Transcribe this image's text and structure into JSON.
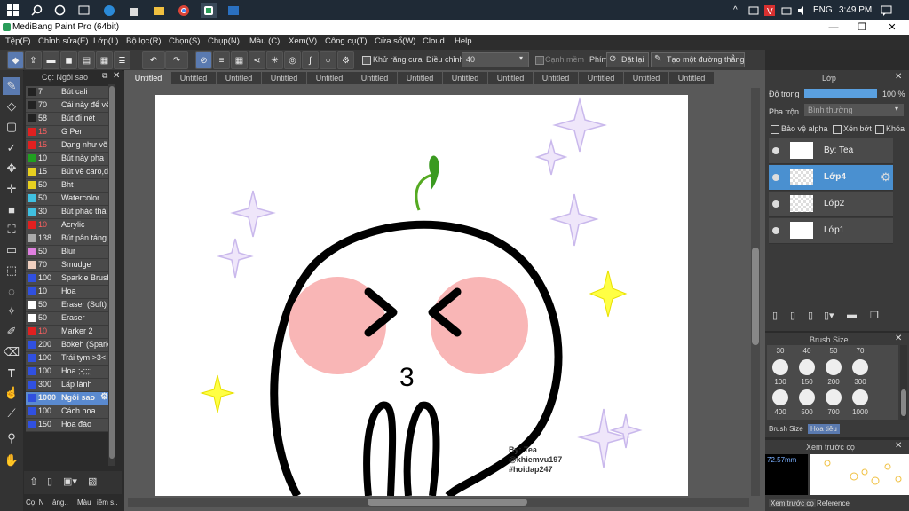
{
  "taskbar": {
    "clock": "3:49 PM",
    "lang": "ENG",
    "chevron": "^"
  },
  "window": {
    "title": "MediBang Paint Pro (64bit)",
    "min": "—",
    "max": "❐",
    "close": "✕"
  },
  "menu": [
    "Tệp(F)",
    "Chỉnh sửa(E)",
    "Lớp(L)",
    "Bộ lọc(R)",
    "Chọn(S)",
    "Chụp(N)",
    "Màu (C)",
    "Xem(V)",
    "Công cụ(T)",
    "Cửa sổ(W)",
    "Cloud",
    "Help"
  ],
  "toolbar": {
    "antialias": "Khử răng cưa",
    "adjust_label": "Điều chỉnh",
    "adjust_value": "40",
    "edge": "Cạnh mềm",
    "key_label": "Phím",
    "reset": "Đặt lại",
    "straight_line": "Tạo một đường thẳng"
  },
  "brush_panel": {
    "title": "Cọ: Ngôi sao",
    "items": [
      {
        "size": "7",
        "name": "Bút cali",
        "color": "#222222"
      },
      {
        "size": "70",
        "name": "Cái này để vẽ",
        "color": "#222222"
      },
      {
        "size": "58",
        "name": "Bút đi nét",
        "color": "#222222"
      },
      {
        "size": "15",
        "name": "G Pen",
        "color": "#e02020"
      },
      {
        "size": "15",
        "name": "Dạng như vẽ",
        "color": "#e02020"
      },
      {
        "size": "10",
        "name": "Bút này pha",
        "color": "#20a020"
      },
      {
        "size": "15",
        "name": "Bút vẽ caro,d",
        "color": "#e8d020"
      },
      {
        "size": "50",
        "name": "Bht",
        "color": "#e8d020"
      },
      {
        "size": "50",
        "name": "Watercolor",
        "color": "#40c0e0"
      },
      {
        "size": "30",
        "name": "Bút phác thả",
        "color": "#40c0e0"
      },
      {
        "size": "10",
        "name": "Acrylic",
        "color": "#e02020"
      },
      {
        "size": "138",
        "name": "Bút pân táng",
        "color": "#aaaaaa"
      },
      {
        "size": "50",
        "name": "Blur",
        "color": "#e080e0"
      },
      {
        "size": "70",
        "name": "Smudge",
        "color": "#f0d0c0"
      },
      {
        "size": "100",
        "name": "Sparkle Brush",
        "color": "#3050e0"
      },
      {
        "size": "10",
        "name": "Hoa",
        "color": "#3050e0"
      },
      {
        "size": "50",
        "name": "Eraser (Soft)",
        "color": "#ffffff"
      },
      {
        "size": "50",
        "name": "Eraser",
        "color": "#ffffff"
      },
      {
        "size": "10",
        "name": "Marker 2",
        "color": "#e02020"
      },
      {
        "size": "200",
        "name": "Bokeh (Spark",
        "color": "#3050e0"
      },
      {
        "size": "100",
        "name": "Trái tym >3<",
        "color": "#3050e0"
      },
      {
        "size": "100",
        "name": "Hoa ;-;;;;",
        "color": "#3050e0"
      },
      {
        "size": "300",
        "name": "Lấp lánh",
        "color": "#3050e0"
      },
      {
        "size": "1000",
        "name": "Ngôi sao",
        "color": "#3050e0"
      },
      {
        "size": "100",
        "name": "Cách hoa",
        "color": "#3050e0"
      },
      {
        "size": "150",
        "name": "Hoa đào",
        "color": "#3050e0"
      }
    ],
    "bottom_tabs": [
      "Cọ: N",
      "ảng..",
      "Màu",
      "iểm s.."
    ]
  },
  "doc_tabs": [
    "Untitled",
    "Untitled",
    "Untitled",
    "Untitled",
    "Untitled",
    "Untitled",
    "Untitled",
    "Untitled",
    "Untitled",
    "Untitled",
    "Untitled",
    "Untitled",
    "Untitled"
  ],
  "canvas": {
    "signature1": "By: Tea",
    "signature2": "@khiemvu197",
    "signature3": "#hoidap247",
    "mouth": "3"
  },
  "layer_panel": {
    "title": "Lớp",
    "opacity_label": "Độ trong",
    "opacity_value": "100 %",
    "blend_label": "Pha trộn",
    "blend_value": "Bình thường",
    "alpha_protect": "Bảo vệ alpha",
    "clipping": "Xén bớt",
    "lock": "Khóa",
    "layers": [
      {
        "name": "By: Tea"
      },
      {
        "name": "Lớp4"
      },
      {
        "name": "Lớp2"
      },
      {
        "name": "Lớp1"
      }
    ]
  },
  "brush_size_panel": {
    "title": "Brush Size",
    "row1": [
      "30",
      "40",
      "50",
      "70"
    ],
    "row2": [
      "100",
      "150",
      "200",
      "300"
    ],
    "row3": [
      "400",
      "500",
      "700",
      "1000"
    ],
    "tabs": [
      "Brush Size",
      "Hoa tiêu"
    ]
  },
  "preview_panel": {
    "title": "Xem trước cọ",
    "size": "72.57mm",
    "tabs": [
      "Xem trước cọ",
      "Reference"
    ]
  }
}
